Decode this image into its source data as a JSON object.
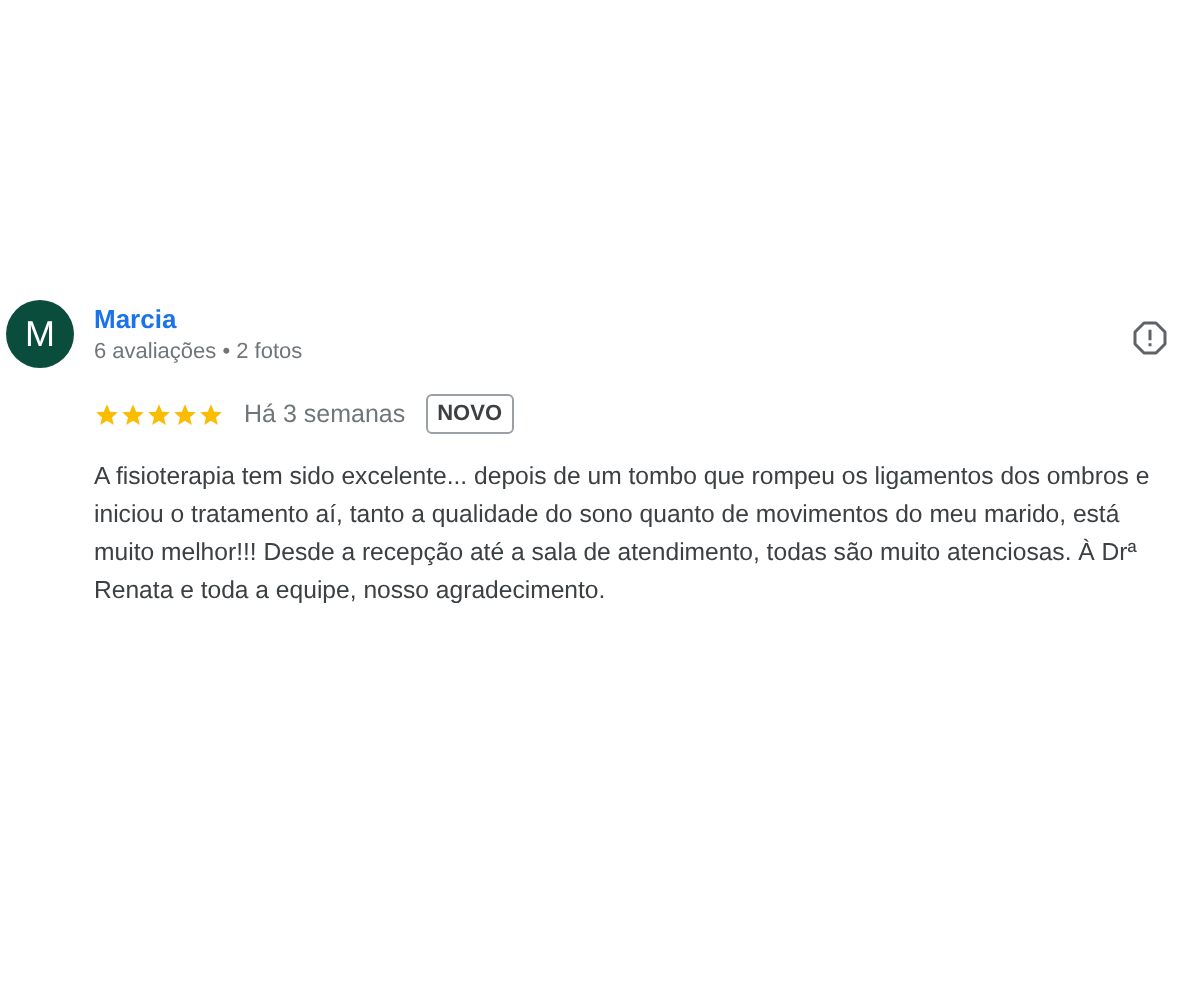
{
  "review": {
    "avatar_letter": "M",
    "author": "Marcia",
    "meta": "6 avaliações • 2 fotos",
    "stars": 5,
    "time": "Há 3 semanas",
    "badge": "NOVO",
    "text": "A fisioterapia tem sido excelente... depois de um tombo que rompeu os ligamentos dos ombros e iniciou o tratamento aí, tanto a qualidade do sono quanto de movimentos do meu marido, está muito melhor!!! Desde a recepção até a sala de atendimento, todas são muito atenciosas. À Drª Renata e toda a equipe, nosso agradecimento."
  }
}
